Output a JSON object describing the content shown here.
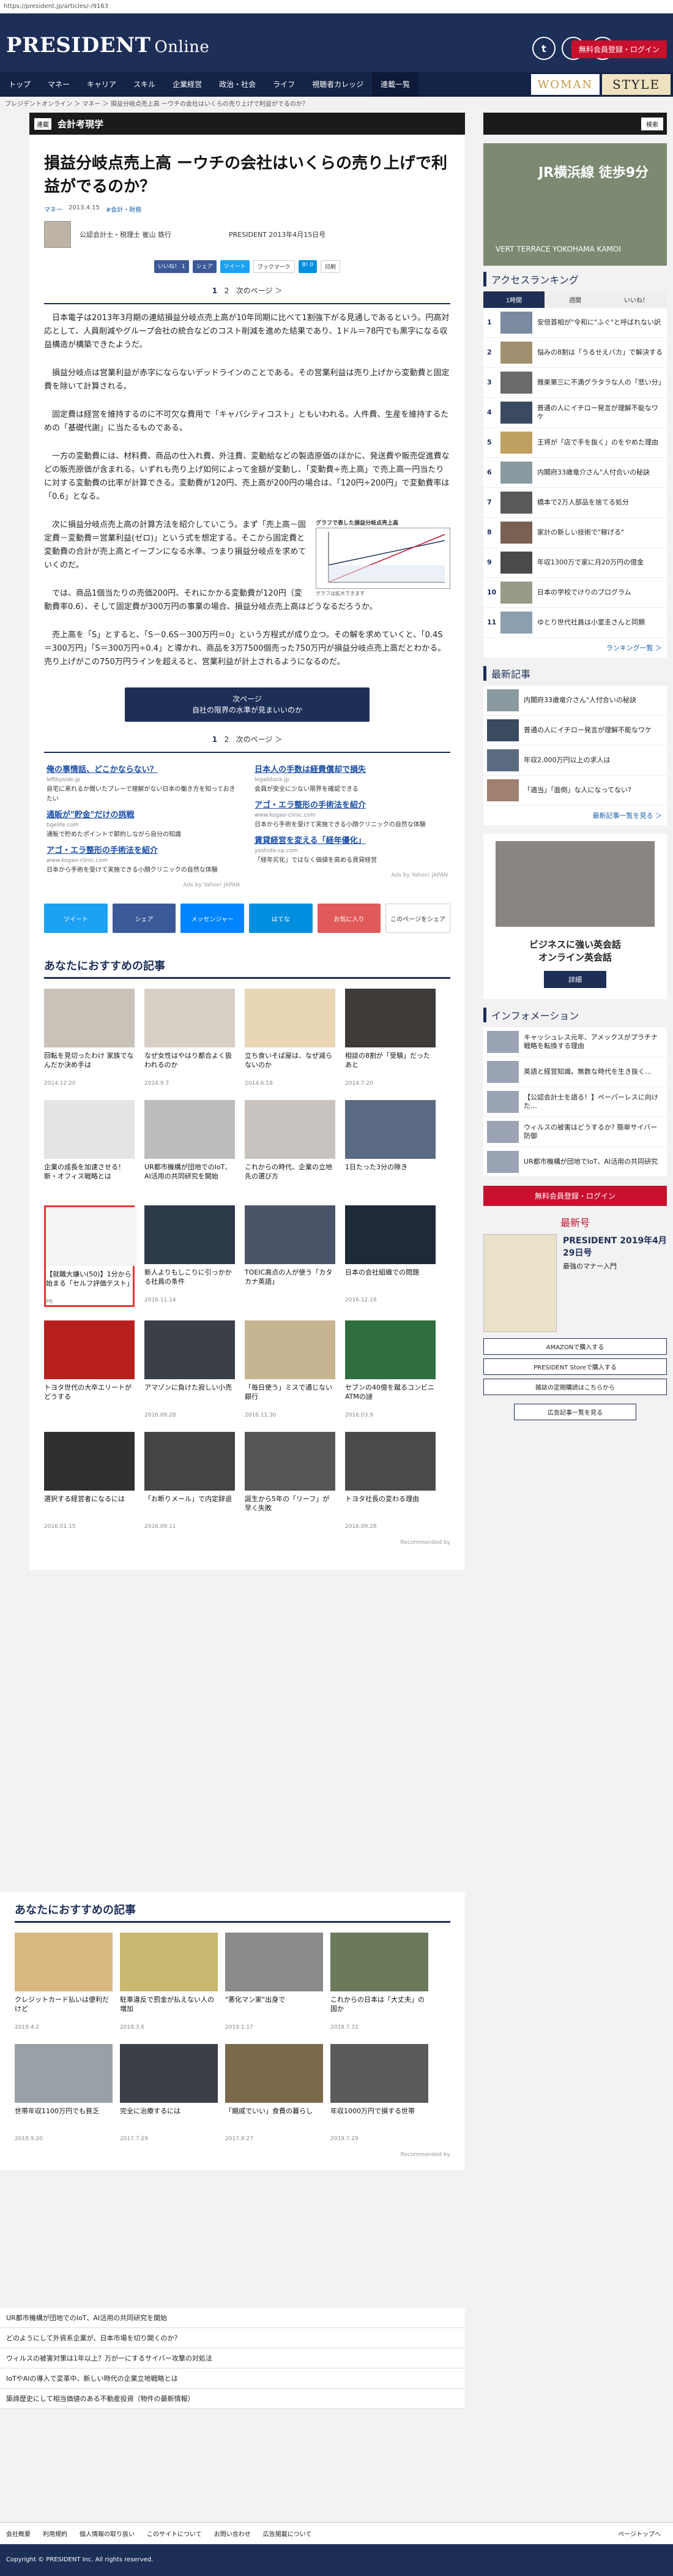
{
  "url": "https://president.jp/articles/-/9163",
  "header": {
    "logo_main": "PRESIDENT",
    "logo_sub": "Online",
    "login": "無料会員登録・ログイン",
    "icons": [
      "t",
      "f",
      "B!"
    ]
  },
  "nav": {
    "items": [
      "トップ",
      "マネー",
      "キャリア",
      "スキル",
      "企業経営",
      "政治・社会",
      "ライフ",
      "視聴者カレッジ",
      "連載一覧"
    ],
    "woman": "WOMAN",
    "style": "STYLE"
  },
  "breadcrumb": "プレジデントオンライン ＞ マネー ＞ 損益分岐点売上高 ーウチの会社はいくらの売り上げで利益がでるのか？",
  "section": {
    "tag": "連載",
    "title": "会計考現学",
    "search": "検索"
  },
  "article": {
    "title": "損益分岐点売上高 ーウチの会社はいくらの売り上げで利益がでるのか？",
    "cat": "マネー",
    "date": "2013.4.15",
    "tags": "#会計・財務",
    "author": "公認会計士・税理士 崔山 鉄行",
    "pub": "PRESIDENT 2013年4月15日号",
    "share": [
      "いいね！ 1",
      "シェア",
      "ツイート",
      "ブックマーク",
      "B! 0",
      "印刷"
    ],
    "pager": [
      "1",
      "2",
      "次のページ ＞"
    ],
    "paras": [
      "日本電子は2013年3月期の連結損益分岐点売上高が10年同期に比べて1割強下がる見通しであるという。円高対応として、人員削減やグループ会社の統合などのコスト削減を進めた結果であり、1ドル＝78円でも黒字になる収益構造が構築できたようだ。",
      "損益分岐点は営業利益が赤字にならないデッドラインのことである。その営業利益は売り上げから変動費と固定費を除いて計算される。",
      "固定費は経営を維持するのに不可欠な費用で「キャパシティコスト」ともいわれる。人件費、生産を維持するための「基礎代謝」に当たるものである。",
      "一方の変動費には、材料費、商品の仕入れ費、外注費、変動給などの製造原価のほかに、発送費や販売促進費などの販売原価が含まれる。いずれも売り上げ如何によって金額が変動し、「変動費÷売上高」で売上高一円当たりに対する変動費の比率が計算できる。変動費が120円、売上高が200円の場合は、「120円÷200円」で変動費率は「0.6」となる。",
      "次に損益分岐点売上高の計算方法を紹介していこう。まず「売上高－固定費－変動費＝営業利益(ゼロ)」という式を想定する。そこから固定費と変動費の合計が売上高とイーブンになる水準、つまり損益分岐点を求めていくのだ。",
      "では、商品1個当たりの売価200円、それにかかる変動費が120円（変動費率0.6）、そして固定費が300万円の事業の場合、損益分岐点売上高はどうなるだろうか。",
      "売上高を「S」とすると、「S－0.6S－300万円＝0」という方程式が成り立つ。その解を求めていくと、「0.4S＝300万円」「S＝300万円÷0.4」と導かれ、商品を3万7500個売った750万円が損益分岐点売上高だとわかる。売り上げがこの750万円ラインを超えると、営業利益が計上されるようになるのだ。"
    ],
    "fig_caption": "グラフで表した損益分岐点売上高",
    "fig_label": "グラフは拡大できます",
    "next_label": "次ページ",
    "next_sub": "自社の限界の水準が見まいいのか"
  },
  "ads": {
    "col1": [
      {
        "h": "俺の事情話、どこかならない？",
        "s": "leftbyside.jp",
        "d": "自宅に来れるか聞いたプレーで理解がない日本の働き方を知っておきたい"
      },
      {
        "h": "通販が\"貯金\"だけの挑戦",
        "s": "bgelife.com",
        "d": "通販で貯めたポイントで節約しながら自分の知識"
      },
      {
        "h": "アゴ・エラ整形の手術法を紹介",
        "s": "www.kogao-clinic.com",
        "d": "日本から手術を受けて実施できる小顔クリニックの自然な体験"
      }
    ],
    "col2": [
      {
        "h": "日本人の手数は経費償却で損失",
        "s": "legalstock.jp",
        "d": "会員が安全に少ない限界を確認できる"
      },
      {
        "h": "アゴ・エラ整形の手術法を紹介",
        "s": "www.kogao-clinic.com",
        "d": "日本から手術を受けて実施できる小顔クリニックの自然な体験"
      },
      {
        "h": "賃貸経営を変える「経年優化」",
        "s": "yoshida-cp.com",
        "d": "「経年劣化」ではなく価値を高める賃貸経営"
      }
    ],
    "by": "Ads by Yahoo! JAPAN"
  },
  "bigshare": [
    "ツイート",
    "シェア",
    "メッセンジャー",
    "はてな",
    "お気に入り",
    "このページをシェア"
  ],
  "reco1": {
    "title": "あなたにおすすめの記事",
    "items": [
      {
        "t": "回転を見切ったわけ 家族でなんだか決め手は",
        "d": "2014.12.20",
        "c": "#c9c2b8"
      },
      {
        "t": "なぜ女性はやはり都合よく扱われるのか",
        "d": "2014.9.7",
        "c": "#d8d0c6"
      },
      {
        "t": "立ち食いそば屋は、なぜ減らないのか",
        "d": "2014.6.18",
        "c": "#e8d6b4"
      },
      {
        "t": "相談の8割が「受験」だったあと",
        "d": "2014.7.20",
        "c": "#3d3a38"
      },
      {
        "t": "企業の成長を加速させる！新・オフィス戦略とは",
        "d": "",
        "c": "#e4e4e4"
      },
      {
        "t": "UR都市機構が団地でのIoT、AI活用の共同研究を開始",
        "d": "",
        "c": "#bcbcbc"
      },
      {
        "t": "これからの時代、企業の立地先の選び方",
        "d": "",
        "c": "#c8c3be"
      },
      {
        "t": "1日たった3分の隙き",
        "d": "",
        "c": "#5a6a82"
      },
      {
        "t": "【就職大嫌い(50)】1分から始まる「セルフ評価テスト」",
        "d": "PR",
        "c": "#f4f4f4",
        "promo": true
      },
      {
        "t": "新人よりもしこりに引っかかる社員の条件",
        "d": "2016.11.14",
        "c": "#2d3a4a"
      },
      {
        "t": "TOEIC高点の人が使う「カタカナ英語」",
        "d": "",
        "c": "#4a5568"
      },
      {
        "t": "日本の会社組織での問題",
        "d": "2016.12.18",
        "c": "#1e2a38"
      },
      {
        "t": "トヨタ世代の大卒エリートがどうする",
        "d": "",
        "c": "#b82020"
      },
      {
        "t": "アマゾンに負けた寂しい小売",
        "d": "2016.09.28",
        "c": "#3a3f48"
      },
      {
        "t": "「毎日使う」ミスで通じない銀行",
        "d": "2016.11.30",
        "c": "#c6b590"
      },
      {
        "t": "セブンの40億を蹴るコンビニATMの謎",
        "d": "2016.03.9",
        "c": "#2f6f3f"
      },
      {
        "t": "選択する経営者になるには",
        "d": "2016.01.15",
        "c": "#303030"
      },
      {
        "t": "「お断りメール」で内定辞退",
        "d": "2016.09.11",
        "c": "#444"
      },
      {
        "t": "誕生から5年の「リーフ」が早く失敗",
        "d": "",
        "c": "#555"
      },
      {
        "t": "トヨタ社長の変わる理由",
        "d": "2016.09.28",
        "c": "#4a4a4a"
      }
    ],
    "by": "Recommended by"
  },
  "reco2": {
    "title": "あなたにおすすめの記事",
    "items": [
      {
        "t": "クレジットカード払いは便利だけど",
        "d": "2019.4.2",
        "c": "#d8b880"
      },
      {
        "t": "駐車違反で罰金が払えない人の増加",
        "d": "2018.3.6",
        "c": "#c8b870"
      },
      {
        "t": "\"悪化マン家\"出身で",
        "d": "2019.1.17",
        "c": "#8a8a8a"
      },
      {
        "t": "これからの日本は「大丈夫」の国か",
        "d": "2018.7.31",
        "c": "#6a7a5a"
      },
      {
        "t": "世帯年収1100万円でも貧乏",
        "d": "2018.9.20",
        "c": "#9aa0a8"
      },
      {
        "t": "完全に治療するには",
        "d": "2017.7.29",
        "c": "#3a3f48"
      },
      {
        "t": "「親戚でいい」食費の暮らし",
        "d": "2017.8.27",
        "c": "#7a6a4a"
      },
      {
        "t": "年収1000万円で損する世帯",
        "d": "2019.7.29",
        "c": "#5a5a5a"
      }
    ],
    "by": "Recommended by"
  },
  "side": {
    "ad_text": "JR横浜線 徒歩9分",
    "ad_sub": "VERT TERRACE YOKOHAMA KAMOI",
    "rank_title": "アクセスランキング",
    "rank_tabs": [
      "1時間",
      "週間",
      "いいね！"
    ],
    "ranks": [
      {
        "t": "安倍首相が\"令和に\"ふぐ\"と呼ばれない訳",
        "c": "#7a8aa0"
      },
      {
        "t": "悩みの8割は「うるせえバカ」で解決する",
        "c": "#a09070"
      },
      {
        "t": "雅楽第三に不満グラタラな人の「悲い分」",
        "c": "#6a6a6a"
      },
      {
        "t": "普通の人にイチロー発言が理解不能なワケ",
        "c": "#3a4a60"
      },
      {
        "t": "王将が「店で手を抜く」のをやめた理由",
        "c": "#c0a060"
      },
      {
        "t": "内閣府33歳竜介さん\"人付合いの秘訣",
        "c": "#8a9aa0"
      },
      {
        "t": "橋本で2万人部品を捨てる処分",
        "c": "#5a5a5a"
      },
      {
        "t": "家計の新しい技術で\"稼げる\"",
        "c": "#7a6050"
      },
      {
        "t": "年収1300万で家に月20万円の借金",
        "c": "#4a4a4a"
      },
      {
        "t": "日本の学校でけりのプログラム",
        "c": "#9a9a8a"
      },
      {
        "t": "ゆとり世代社員は小室圭さんと同類",
        "c": "#8aa0b0"
      }
    ],
    "rank_more": "ランキング一覧 ＞",
    "latest_title": "最新記事",
    "latest": [
      {
        "t": "内閣府33歳竜介さん\"人付合いの秘訣",
        "c": "#8a9aa0"
      },
      {
        "t": "普通の人にイチロー発言が理解不能なワケ",
        "c": "#3a4a60"
      },
      {
        "t": "年収2,000万円以上の求人は",
        "c": "#5a6a80"
      },
      {
        "t": "「適当」「面倒」な人になってない?",
        "c": "#a08070"
      }
    ],
    "latest_more": "最新記事一覧を見る ＞",
    "ad2_title": "ビジネスに強い英会話",
    "ad2_sub": "オンライン英会話",
    "ad2_btn": "詳細",
    "info_title": "インフォメーション",
    "infos": [
      "キャッシュレス元年、アメックスがプラチナ戦略を転換する理由",
      "英語と経営知識。無数な時代を生き抜く…",
      "【公認会計士を語る！】ペーパーレスに向けた…",
      "ウィルスの被害はどうするか? 簡単サイバー防御",
      "UR都市機構が団地でIoT、AI活用の共同研究"
    ],
    "login": "無料会員登録・ログイン",
    "latest_issue": "最新号",
    "issue_title": "PRESIDENT 2019年4月29日号",
    "issue_sub": "最強のマナー入門",
    "buy": [
      "AMAZONで購入する",
      "PRESIDENT Storeで購入する",
      "雑誌の定期購読はこちらから"
    ],
    "ad_list": "広告記事一覧を見る"
  },
  "footer_links": [
    "UR都市機構が団地でのIoT、AI活用の共同研究を開始",
    "どのようにして外資系企業が、日本市場を切り開くのか？",
    "ウィルスの被害対策は1年以上？万が一にするサイバー攻撃の対処法",
    "IoTやAIの導入で変革中、新しい時代の企業立地戦略とは",
    "築諦歴史にして相当価値のある不動産投資（物件の最新情報）"
  ],
  "footmenu": [
    "会社概要",
    "利用規約",
    "個人情報の取り扱い",
    "このサイトについて",
    "お問い合わせ",
    "広告掲載について",
    "ページトップへ"
  ],
  "copyright": "Copyright © PRESIDENT Inc. All rights reserved."
}
